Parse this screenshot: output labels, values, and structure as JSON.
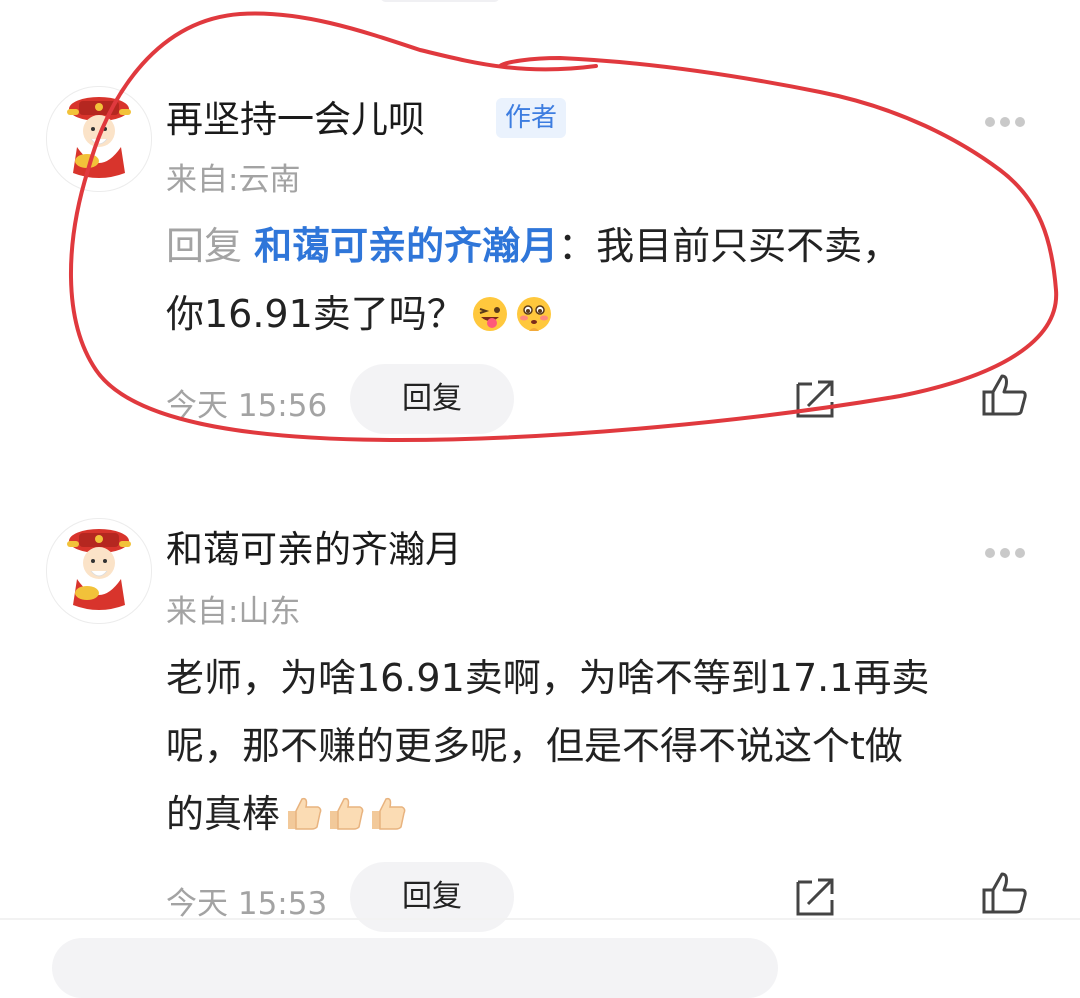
{
  "comments": [
    {
      "username": "再坚持一会儿呗",
      "badge": "作者",
      "location": "来自:云南",
      "reply_prefix": "回复",
      "mention": "和蔼可亲的齐瀚月",
      "text_line1": "：我目前只买不卖，",
      "text_line2": "你16.91卖了吗？",
      "emojis": [
        "winking-tongue-emoji",
        "flushed-emoji"
      ],
      "time": "今天 15:56",
      "reply_button": "回复"
    },
    {
      "username": "和蔼可亲的齐瀚月",
      "location": "来自:山东",
      "text_line1": "老师，为啥16.91卖啊，为啥不等到17.1再卖",
      "text_line2": "呢，那不赚的更多呢，但是不得不说这个t做",
      "text_line3": "的真棒",
      "emojis": [
        "thumbs-up-emoji",
        "thumbs-up-emoji",
        "thumbs-up-emoji"
      ],
      "time": "今天 15:53",
      "reply_button": "回复"
    }
  ],
  "colors": {
    "mention": "#2f76d9",
    "badge_bg": "#eaf2fd",
    "badge_text": "#3d7de0",
    "annotation_ring": "#e0393e",
    "muted_text": "#a3a3a3"
  },
  "icons": [
    "avatar-caishen",
    "more-icon",
    "share-icon",
    "like-icon"
  ]
}
